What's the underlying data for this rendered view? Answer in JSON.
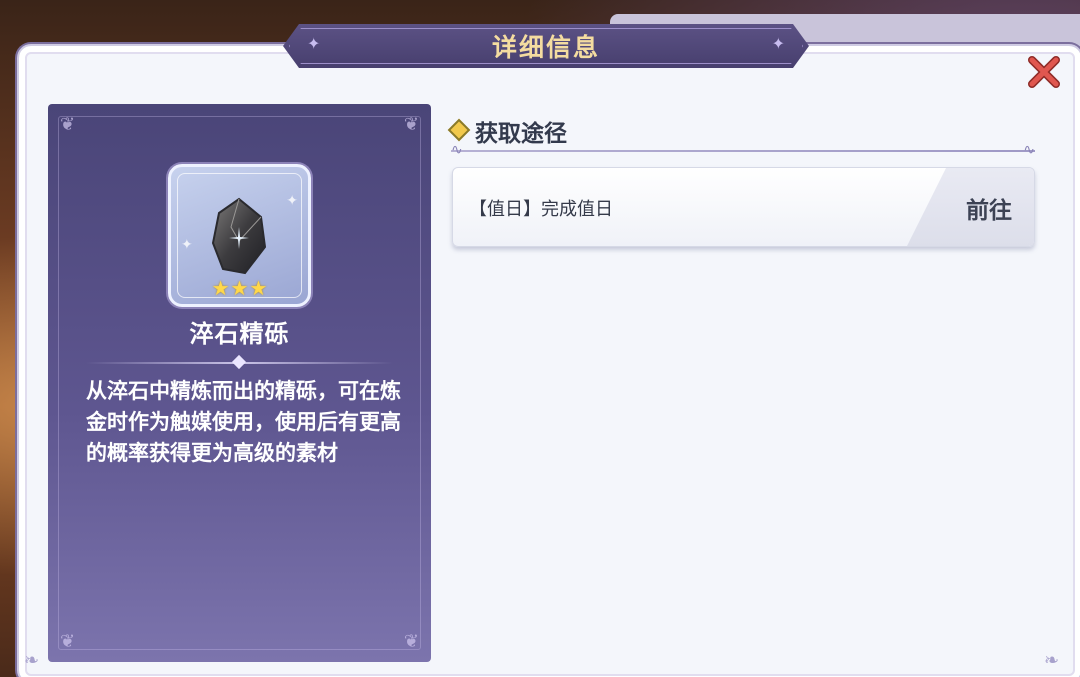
{
  "dialog": {
    "title": "详细信息"
  },
  "item": {
    "name": "淬石精砾",
    "rarity_stars": 3,
    "icon": "rough-stone-icon",
    "description": "从淬石中精炼而出的精砾，可在炼金时作为触媒使用，使用后有更高的概率获得更为高级的素材"
  },
  "acquire": {
    "heading": "获取途径",
    "sources": [
      {
        "label": "【值日】完成值日",
        "action": "前往"
      }
    ]
  },
  "colors": {
    "title_text": "#f4dca0",
    "close_x": "#d9534f",
    "star": "#ffd84a",
    "card_top": "#4a4578",
    "card_bottom": "#7c74ad"
  }
}
